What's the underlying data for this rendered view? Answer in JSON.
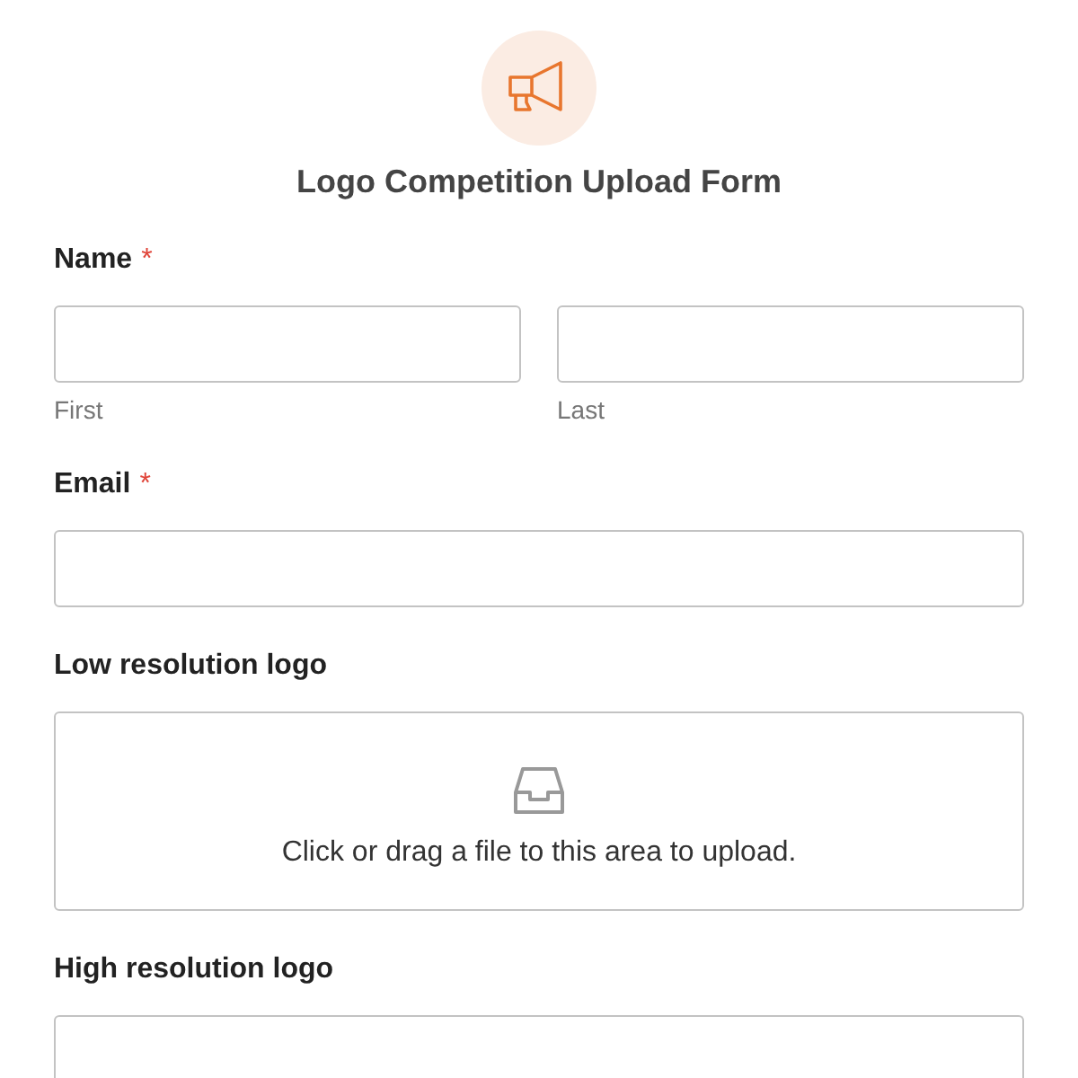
{
  "form": {
    "title": "Logo Competition Upload Form"
  },
  "required_mark": "*",
  "fields": [
    {
      "kind": "name",
      "label": "Name",
      "required": true,
      "sublabels": [
        "First",
        "Last"
      ]
    },
    {
      "kind": "email",
      "label": "Email",
      "required": true
    },
    {
      "kind": "upload",
      "label": "Low resolution logo",
      "required": false,
      "hint": "Click or drag a file to this area to upload."
    },
    {
      "kind": "upload",
      "label": "High resolution logo",
      "required": false
    }
  ]
}
